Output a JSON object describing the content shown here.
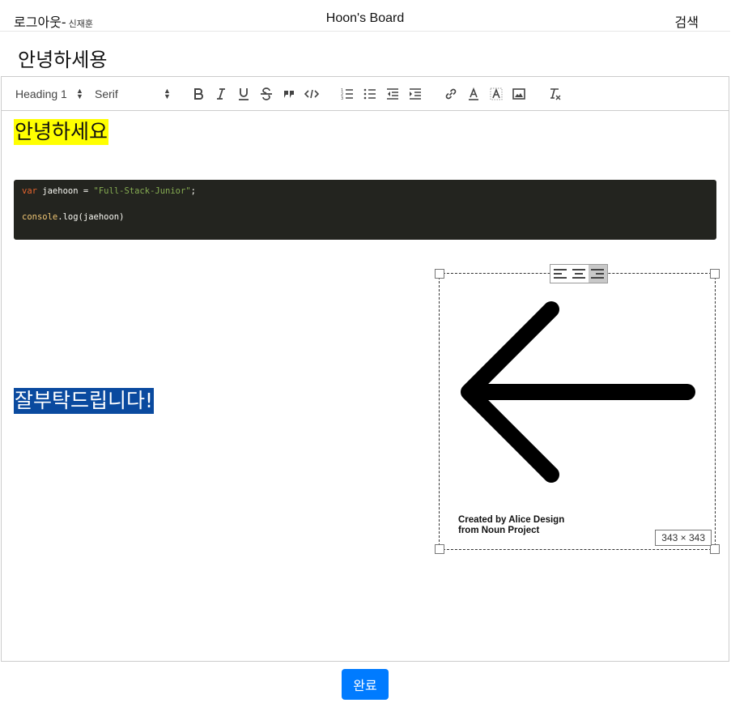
{
  "header": {
    "logout_label": "로그아웃-",
    "username": "신재훈",
    "brand": "Hoon's Board",
    "search_label": "검색"
  },
  "post": {
    "title": "안녕하세용"
  },
  "toolbar": {
    "heading_value": "Heading 1",
    "font_value": "Serif"
  },
  "content": {
    "heading_text": "안녕하세요",
    "code": {
      "kw": "var",
      "ident": " jaehoon ",
      "op": "= ",
      "str": "\"Full-Stack-Junior\"",
      "semi": ";",
      "fn": "console",
      "call": ".log(jaehoon)"
    },
    "highlight_text": "잘부탁드립니다!",
    "image": {
      "credit_line1": "Created by Alice Design",
      "credit_line2": "from Noun Project",
      "size_label": "343 × 343"
    }
  },
  "actions": {
    "submit_label": "완료"
  },
  "colors": {
    "accent": "#007bff",
    "highlight_yellow": "#ffff00",
    "highlight_blue": "#0a4a9f",
    "code_bg": "#23241f"
  }
}
